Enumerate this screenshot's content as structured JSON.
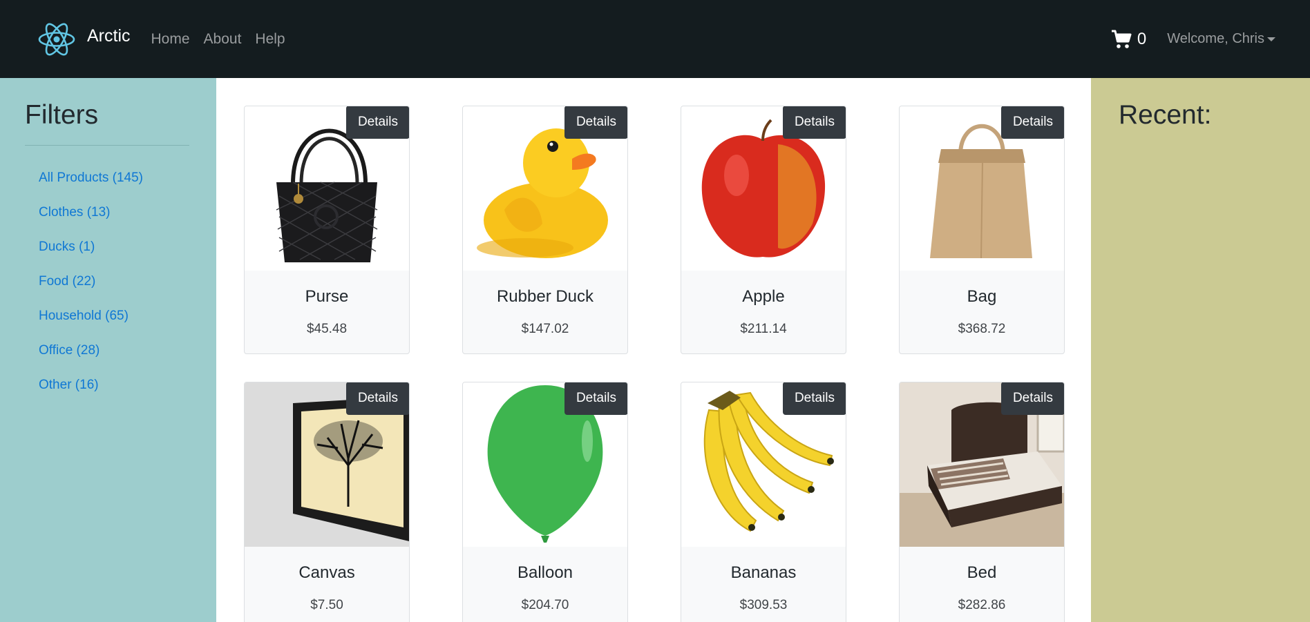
{
  "navbar": {
    "brand": "Arctic",
    "links": [
      "Home",
      "About",
      "Help"
    ],
    "cart_count": "0",
    "user_label": "Welcome, Chris"
  },
  "sidebar": {
    "title": "Filters",
    "filters": [
      {
        "label": "All Products (145)"
      },
      {
        "label": "Clothes (13)"
      },
      {
        "label": "Ducks (1)"
      },
      {
        "label": "Food (22)"
      },
      {
        "label": "Household (65)"
      },
      {
        "label": "Office (28)"
      },
      {
        "label": "Other (16)"
      }
    ]
  },
  "products": [
    {
      "name": "Purse",
      "price": "$45.48",
      "button": "Details",
      "image": "purse-image"
    },
    {
      "name": "Rubber Duck",
      "price": "$147.02",
      "button": "Details",
      "image": "rubber-duck-image"
    },
    {
      "name": "Apple",
      "price": "$211.14",
      "button": "Details",
      "image": "apple-image"
    },
    {
      "name": "Bag",
      "price": "$368.72",
      "button": "Details",
      "image": "paper-bag-image"
    },
    {
      "name": "Canvas",
      "price": "$7.50",
      "button": "Details",
      "image": "canvas-image"
    },
    {
      "name": "Balloon",
      "price": "$204.70",
      "button": "Details",
      "image": "balloon-image"
    },
    {
      "name": "Bananas",
      "price": "$309.53",
      "button": "Details",
      "image": "bananas-image"
    },
    {
      "name": "Bed",
      "price": "$282.86",
      "button": "Details",
      "image": "bed-image"
    }
  ],
  "recent": {
    "title": "Recent:"
  },
  "colors": {
    "navbar_bg": "#141c1f",
    "sidebar_bg": "#9dcdcd",
    "recent_bg": "#cbca93",
    "link": "#0f77d4",
    "button_bg": "#343a40"
  }
}
